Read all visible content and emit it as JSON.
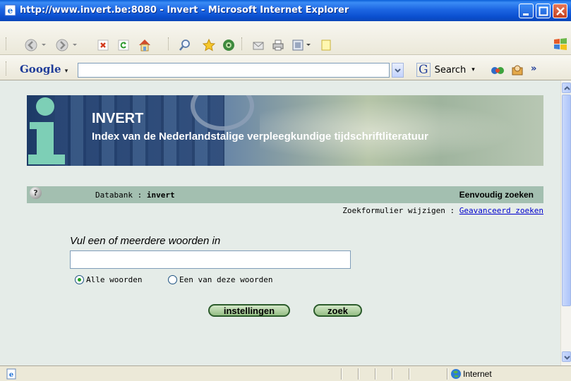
{
  "window": {
    "title": "http://www.invert.be:8080 - Invert - Microsoft Internet Explorer"
  },
  "googlebar": {
    "logo": "Google",
    "search_label": "Search",
    "chevron": "»"
  },
  "banner": {
    "title": "INVERT",
    "subtitle": "Index van de Nederlandstalige verpleegkundige tijdschriftliteratuur"
  },
  "infobar": {
    "db_label": "Databank : ",
    "db_name": "invert",
    "mode": "Eenvoudig zoeken"
  },
  "change_form": {
    "label": "Zoekformulier wijzigen : ",
    "link": "Geavanceerd zoeken"
  },
  "search": {
    "prompt": "Vul een of meerdere woorden in",
    "value": "",
    "options": [
      {
        "label": "Alle woorden",
        "selected": true
      },
      {
        "label": "Een van deze woorden",
        "selected": false
      }
    ],
    "settings_button": "instellingen",
    "search_button": "zoek"
  },
  "status": {
    "zone": "Internet"
  }
}
